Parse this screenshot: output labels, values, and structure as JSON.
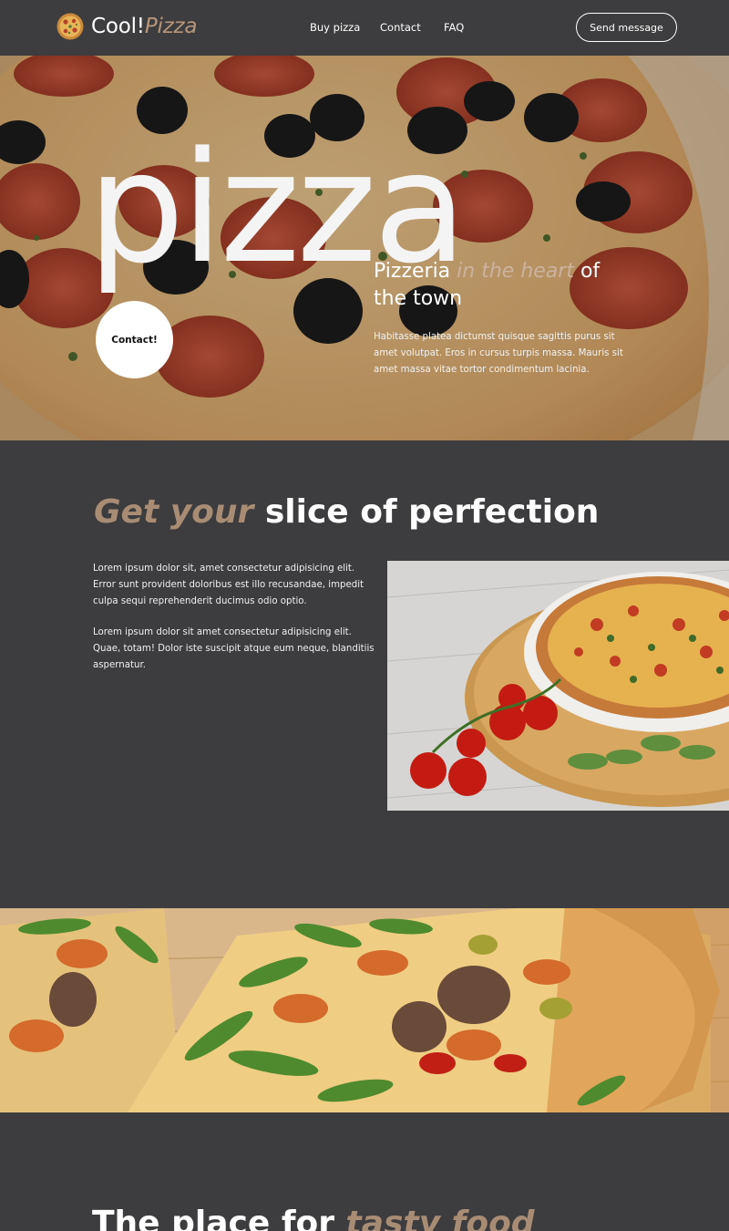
{
  "header": {
    "brand_main": "Cool!",
    "brand_accent": "Pizza",
    "logo_icon": "pizza-logo-icon",
    "nav": [
      {
        "label": "Buy pizza"
      },
      {
        "label": "Contact"
      },
      {
        "label": "FAQ"
      }
    ],
    "cta_label": "Send message"
  },
  "hero": {
    "big_word": "pizza",
    "tagline_pre": "Pizzeria",
    "tagline_accent": "in the heart",
    "tagline_post": "of the town",
    "description": "Habitasse platea dictumst quisque sagittis purus sit amet volutpat. Eros in cursus turpis massa. Mauris sit amet massa vitae tortor condimentum lacinia.",
    "contact_label": "Contact!"
  },
  "section2": {
    "title_accent": "Get your",
    "title_rest": "slice of perfection",
    "paragraph1": "Lorem ipsum dolor sit, amet consectetur adipisicing elit. Error sunt provident doloribus est illo recusandae, impedit culpa sequi reprehenderit ducimus odio optio.",
    "paragraph2": "Lorem ipsum dolor sit amet consectetur adipisicing elit. Quae, totam! Dolor iste suscipit atque eum neque, blanditiis aspernatur."
  },
  "section3": {
    "title_pre": "The place for",
    "title_accent": "tasty food"
  },
  "colors": {
    "background": "#3d3c3e",
    "accent": "#a88c74",
    "text": "#ffffff"
  }
}
